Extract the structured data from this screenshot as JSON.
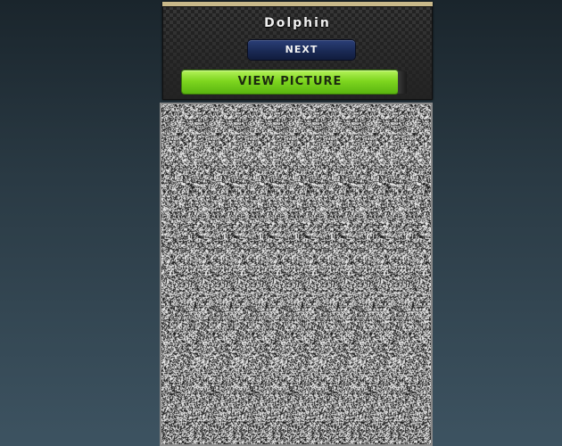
{
  "header": {
    "title": "Dolphin",
    "next_label": "NEXT",
    "view_label": "VIEW PICTURE"
  },
  "colors": {
    "panel_border": "#c9b98a",
    "next_button": "#1a2a55",
    "view_button": "#7ed61f",
    "background_top": "#1a252c",
    "background_bottom": "#3d5361"
  },
  "stereogram": {
    "hidden_subject": "Dolphin"
  }
}
